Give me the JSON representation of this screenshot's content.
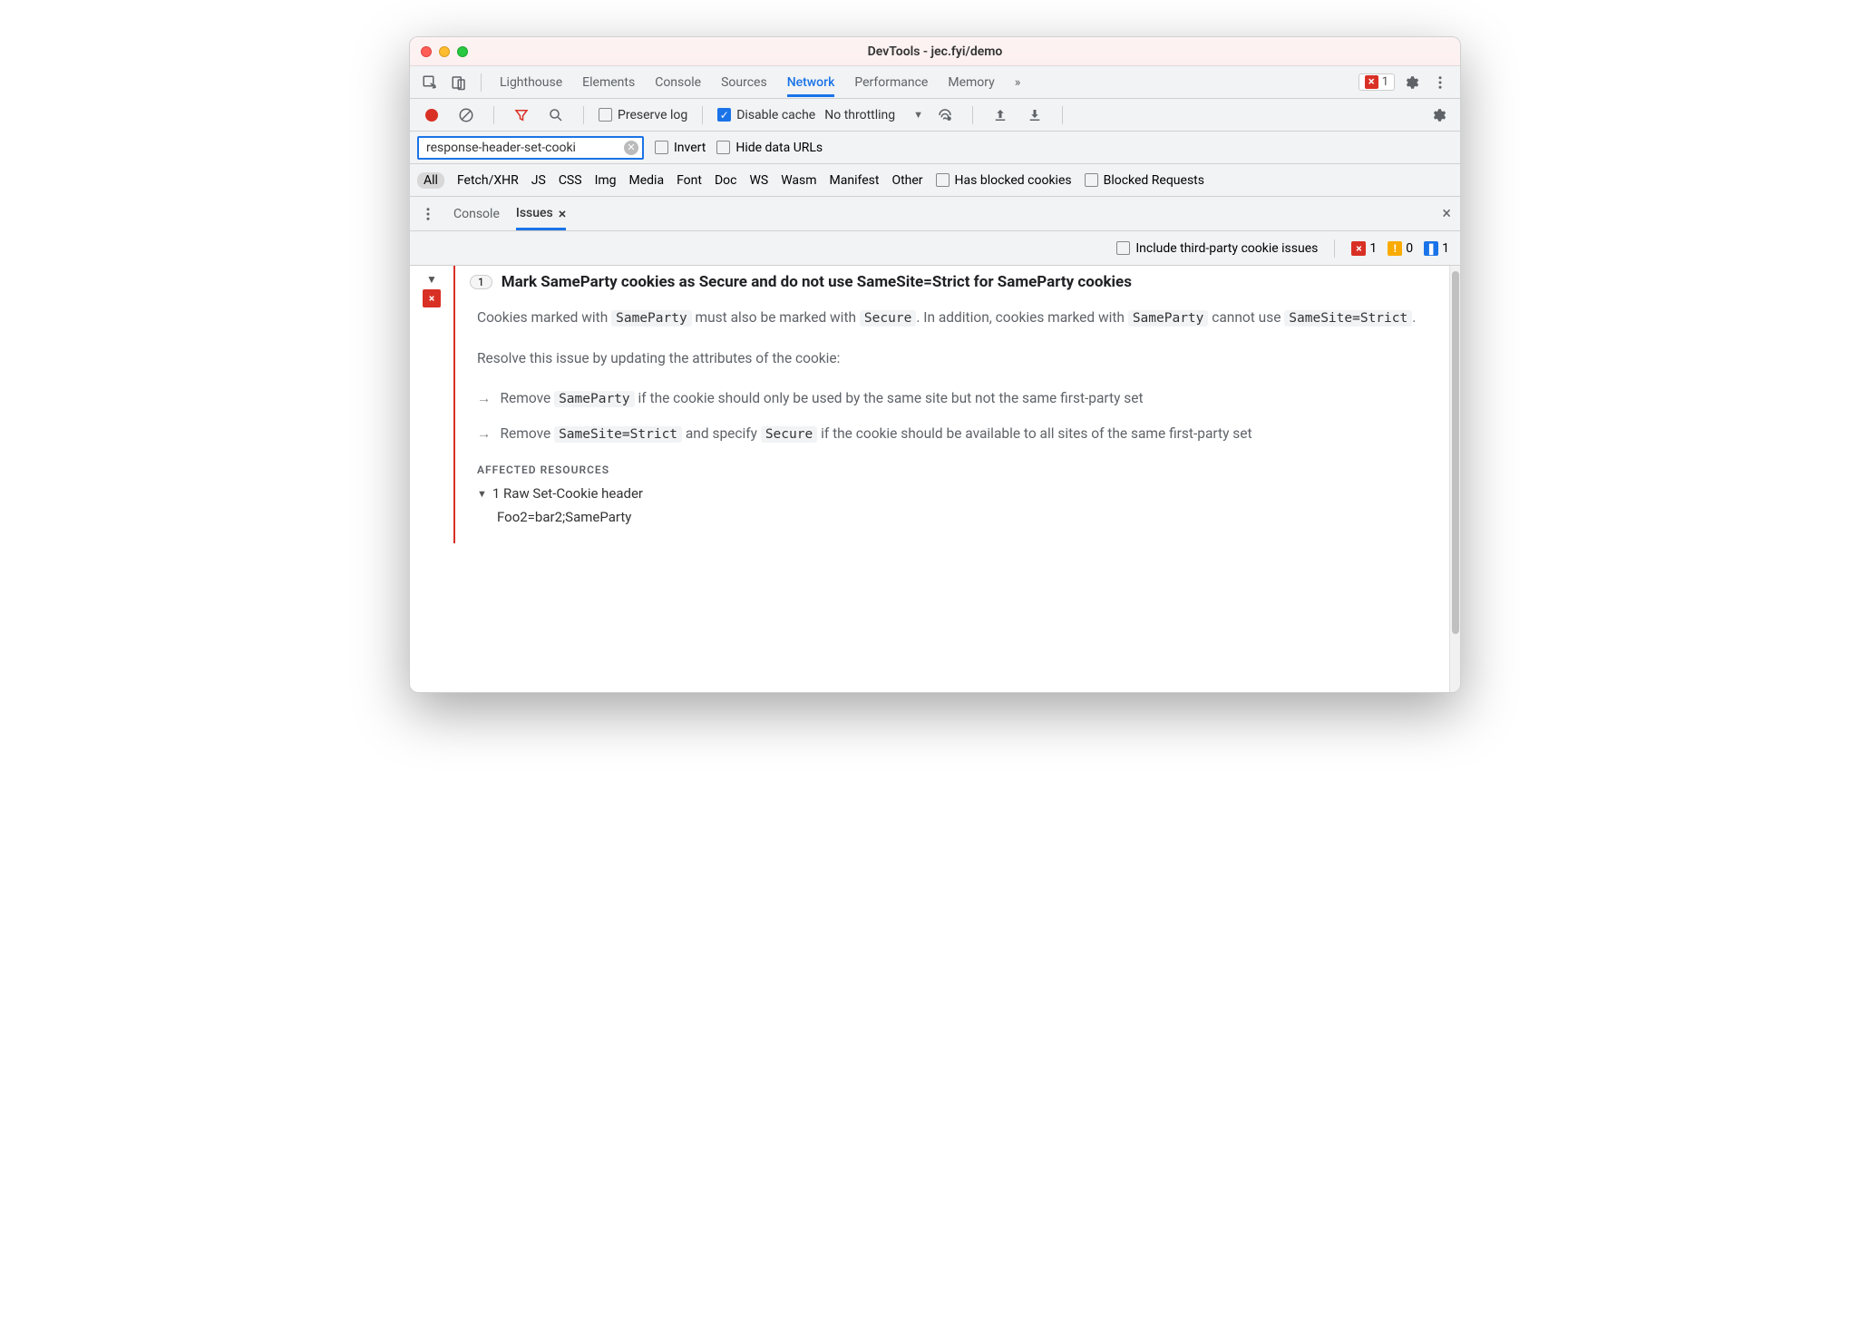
{
  "window": {
    "title": "DevTools - jec.fyi/demo"
  },
  "mainTabs": {
    "items": [
      "Lighthouse",
      "Elements",
      "Console",
      "Sources",
      "Network",
      "Performance",
      "Memory"
    ],
    "active": "Network",
    "overflow": "»",
    "errorCount": "1"
  },
  "networkBar": {
    "preserveLog": "Preserve log",
    "disableCache": "Disable cache",
    "throttling": "No throttling"
  },
  "filter": {
    "value": "response-header-set-cooki",
    "invert": "Invert",
    "hideDataUrls": "Hide data URLs"
  },
  "types": {
    "all": "All",
    "items": [
      "Fetch/XHR",
      "JS",
      "CSS",
      "Img",
      "Media",
      "Font",
      "Doc",
      "WS",
      "Wasm",
      "Manifest",
      "Other"
    ],
    "hasBlocked": "Has blocked cookies",
    "blockedReq": "Blocked Requests"
  },
  "drawer": {
    "tab1": "Console",
    "tab2": "Issues"
  },
  "issuesBar": {
    "include": "Include third-party cookie issues",
    "err": "1",
    "warn": "0",
    "info": "1"
  },
  "issue": {
    "count": "1",
    "title": "Mark SameParty cookies as Secure and do not use SameSite=Strict for SameParty cookies",
    "p1a": "Cookies marked with ",
    "c1": "SameParty",
    "p1b": " must also be marked with ",
    "c2": "Secure",
    "p1c": ". In addition, cookies marked with ",
    "c3": "SameParty",
    "p1d": " cannot use ",
    "c4": "SameSite=Strict",
    "p1e": ".",
    "p2": "Resolve this issue by updating the attributes of the cookie:",
    "b1a": "Remove ",
    "b1c": "SameParty",
    "b1b": " if the cookie should only be used by the same site but not the same first-party set",
    "b2a": "Remove ",
    "b2c1": "SameSite=Strict",
    "b2m": " and specify ",
    "b2c2": "Secure",
    "b2b": " if the cookie should be available to all sites of the same first-party set",
    "section": "AFFECTED RESOURCES",
    "resource": "1 Raw Set-Cookie header",
    "cookie": "Foo2=bar2;SameParty"
  }
}
